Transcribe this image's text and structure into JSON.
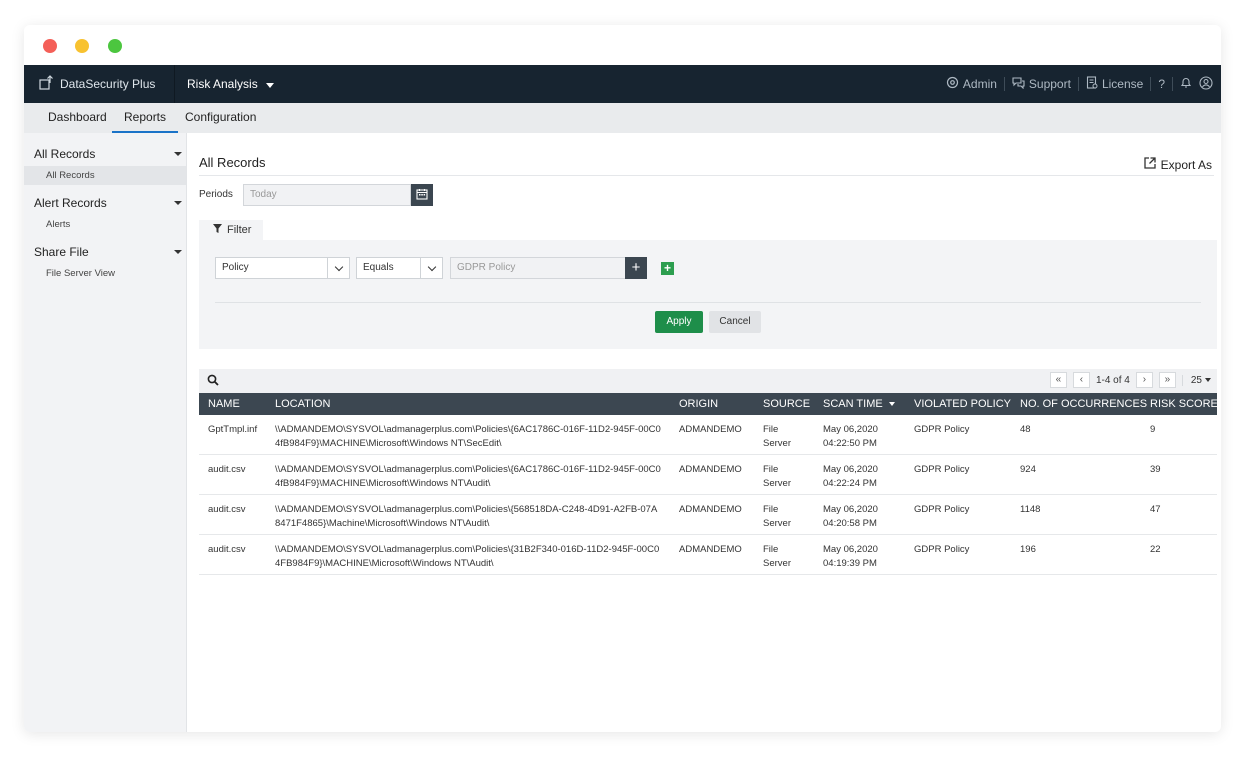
{
  "app": {
    "brand": "DataSecurity Plus",
    "module": "Risk Analysis",
    "top_links": {
      "admin": "Admin",
      "support": "Support",
      "license": "License",
      "help": "?"
    }
  },
  "tabs": [
    {
      "label": "Dashboard"
    },
    {
      "label": "Reports",
      "active": true
    },
    {
      "label": "Configuration"
    }
  ],
  "sidebar": {
    "groups": [
      {
        "label": "All Records",
        "items": [
          {
            "label": "All Records",
            "active": true
          }
        ]
      },
      {
        "label": "Alert Records",
        "items": [
          {
            "label": "Alerts"
          }
        ]
      },
      {
        "label": "Share File",
        "items": [
          {
            "label": "File Server View"
          }
        ]
      }
    ]
  },
  "main": {
    "title": "All Records",
    "export_label": "Export As",
    "periods_label": "Periods",
    "period_placeholder": "Today",
    "filter_tab_label": "Filter",
    "filter": {
      "field_value": "Policy",
      "operator_value": "Equals",
      "value_placeholder": "GDPR Policy",
      "add_label": "+",
      "add_row_label": "+"
    },
    "apply_label": "Apply",
    "cancel_label": "Cancel"
  },
  "pager": {
    "first": "«",
    "prev": "‹",
    "range": "1-4 of 4",
    "next": "›",
    "last": "»",
    "per_page": "25"
  },
  "table": {
    "columns": [
      "NAME",
      "LOCATION",
      "ORIGIN",
      "SOURCE",
      "SCAN TIME",
      "VIOLATED POLICY",
      "NO. OF OCCURRENCES",
      "RISK SCORE"
    ],
    "rows": [
      {
        "name": "GptTmpl.inf",
        "location": "\\\\ADMANDEMO\\SYSVOL\\admanagerplus.com\\Policies\\{6AC1786C-016F-11D2-945F-00C04fB984F9}\\MACHINE\\Microsoft\\Windows NT\\SecEdit\\",
        "origin": "ADMANDEMO",
        "source": "File Server",
        "scan_time": "May 06,2020 04:22:50 PM",
        "policy": "GDPR Policy",
        "occurrences": "48",
        "risk": "9"
      },
      {
        "name": "audit.csv",
        "location": "\\\\ADMANDEMO\\SYSVOL\\admanagerplus.com\\Policies\\{6AC1786C-016F-11D2-945F-00C04fB984F9}\\MACHINE\\Microsoft\\Windows NT\\Audit\\",
        "origin": "ADMANDEMO",
        "source": "File Server",
        "scan_time": "May 06,2020 04:22:24 PM",
        "policy": "GDPR Policy",
        "occurrences": "924",
        "risk": "39"
      },
      {
        "name": "audit.csv",
        "location": "\\\\ADMANDEMO\\SYSVOL\\admanagerplus.com\\Policies\\{568518DA-C248-4D91-A2FB-07A8471F4865}\\Machine\\Microsoft\\Windows NT\\Audit\\",
        "origin": "ADMANDEMO",
        "source": "File Server",
        "scan_time": "May 06,2020 04:20:58 PM",
        "policy": "GDPR Policy",
        "occurrences": "1148",
        "risk": "47"
      },
      {
        "name": "audit.csv",
        "location": "\\\\ADMANDEMO\\SYSVOL\\admanagerplus.com\\Policies\\{31B2F340-016D-11D2-945F-00C04FB984F9}\\MACHINE\\Microsoft\\Windows NT\\Audit\\",
        "origin": "ADMANDEMO",
        "source": "File Server",
        "scan_time": "May 06,2020 04:19:39 PM",
        "policy": "GDPR Policy",
        "occurrences": "196",
        "risk": "22"
      }
    ]
  },
  "colors": {
    "topbar": "#172430",
    "table_header": "#3c4751",
    "apply": "#1e8e4a",
    "active_tab_underline": "#1a73c8"
  },
  "icons": [
    "upload-box-icon",
    "admin-gear-icon",
    "support-chat-icon",
    "license-icon",
    "bell-icon",
    "user-icon",
    "calendar-icon",
    "filter-icon",
    "export-icon",
    "search-icon"
  ]
}
